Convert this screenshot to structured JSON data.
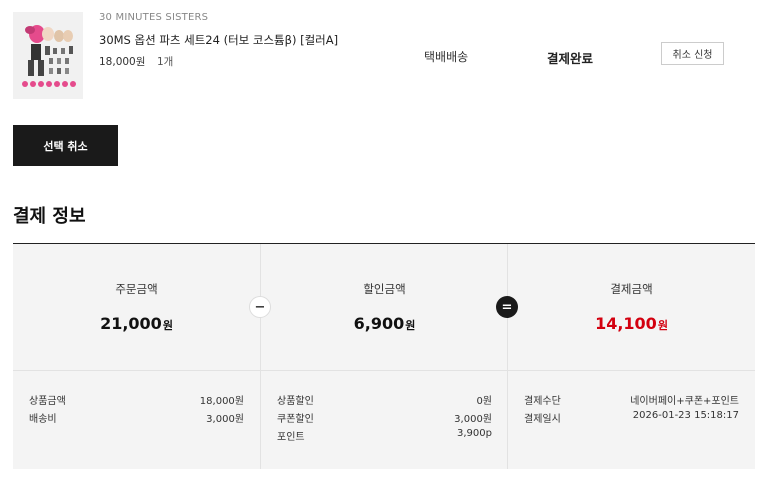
{
  "order_item": {
    "brand": "30 MINUTES SISTERS",
    "name": "30MS 옵션 파츠 세트24 (터보 코스튬β) [컬러A]",
    "price": "18,000원",
    "quantity": "1개",
    "shipping_method": "택배배송",
    "status": "결제완료",
    "cancel_request_label": "취소 신청"
  },
  "select_cancel_label": "선택 취소",
  "payment_section": {
    "title": "결제 정보",
    "order_amount": {
      "label": "주문금액",
      "value": "21,000",
      "unit": "원"
    },
    "discount_amount": {
      "label": "할인금액",
      "value": "6,900",
      "unit": "원"
    },
    "payment_amount": {
      "label": "결제금액",
      "value": "14,100",
      "unit": "원",
      "color": "#d3000f"
    },
    "minus_symbol": "−",
    "equals_symbol": "=",
    "order_details": [
      {
        "label": "상품금액",
        "value": "18,000원"
      },
      {
        "label": "배송비",
        "value": "3,000원"
      }
    ],
    "discount_details": [
      {
        "label": "상품할인",
        "value": "0원"
      },
      {
        "label": "쿠폰할인",
        "value": "3,000원"
      },
      {
        "label": "포인트",
        "value": "3,900p"
      }
    ],
    "payment_details": [
      {
        "label": "결제수단",
        "value": "네이버페이+쿠폰+포인트"
      },
      {
        "label": "결제일시",
        "value": "2026-01-23 15:18:17"
      }
    ]
  }
}
